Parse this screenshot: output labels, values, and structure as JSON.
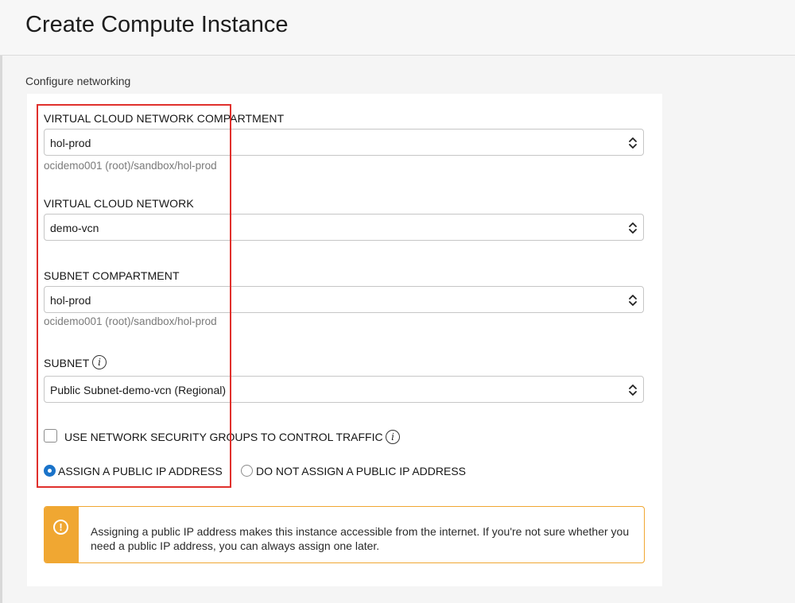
{
  "page": {
    "title": "Create Compute Instance",
    "section_title": "Configure networking"
  },
  "fields": {
    "vcn_compartment": {
      "label": "VIRTUAL CLOUD NETWORK COMPARTMENT",
      "value": "hol-prod",
      "hint": "ocidemo001 (root)/sandbox/hol-prod"
    },
    "vcn": {
      "label": "VIRTUAL CLOUD NETWORK",
      "value": "demo-vcn"
    },
    "subnet_compartment": {
      "label": "SUBNET COMPARTMENT",
      "value": "hol-prod",
      "hint": "ocidemo001 (root)/sandbox/hol-prod"
    },
    "subnet": {
      "label": "SUBNET",
      "value": "Public Subnet-demo-vcn (Regional)"
    }
  },
  "nsg": {
    "label": "USE NETWORK SECURITY GROUPS TO CONTROL TRAFFIC",
    "checked": false
  },
  "public_ip": {
    "options": [
      {
        "label": "ASSIGN A PUBLIC IP ADDRESS",
        "selected": true
      },
      {
        "label": "DO NOT ASSIGN A PUBLIC IP ADDRESS",
        "selected": false
      }
    ]
  },
  "warning": {
    "icon": "exclamation-icon",
    "text": "Assigning a public IP address makes this instance accessible from the internet. If you're not sure whether you need a public IP address, you can always assign one later."
  },
  "icons": {
    "info": "i",
    "exclamation": "!"
  },
  "colors": {
    "accent_blue": "#1a73c9",
    "warning_orange": "#f0a732",
    "highlight_red": "#e0302c"
  }
}
